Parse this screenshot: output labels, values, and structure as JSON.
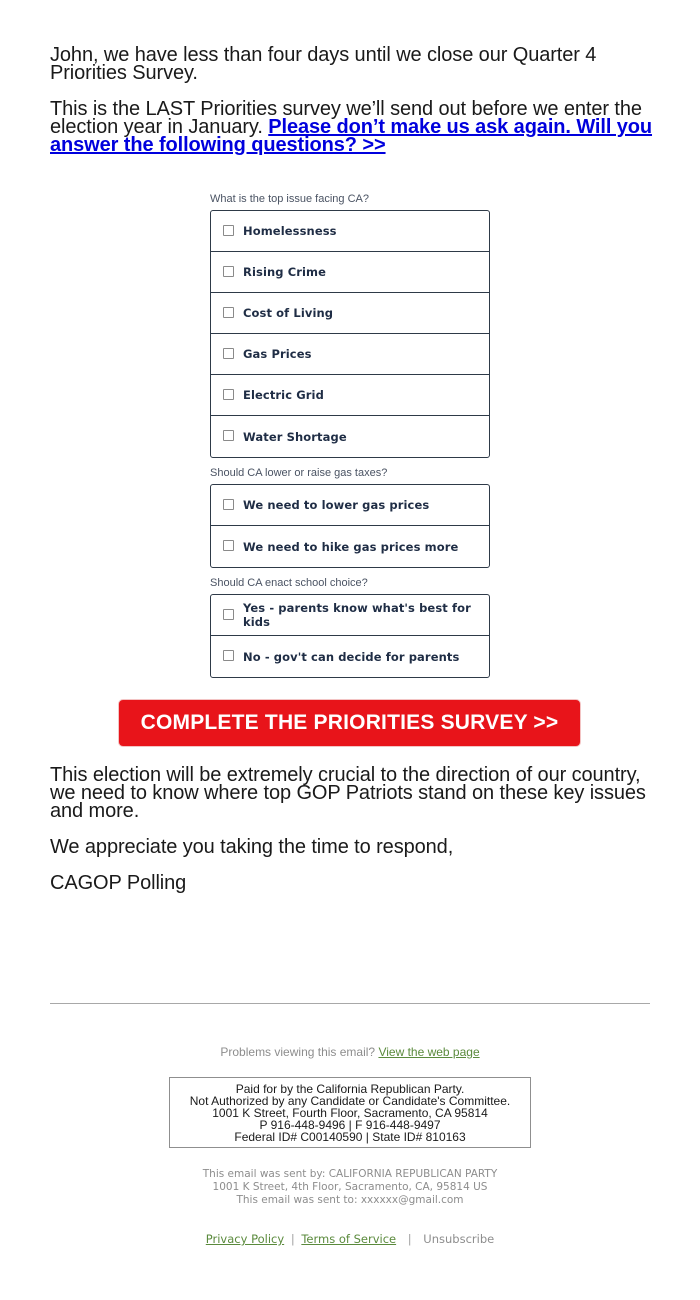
{
  "intro": {
    "para1": "John, we have less than four days until we close our Quarter 4 Priorities Survey.",
    "para2_text": "This is the LAST Priorities survey we’ll send out before we enter the election year in January. ",
    "para2_link": "Please don’t make us ask again. Will you answer the following questions? >>"
  },
  "survey": {
    "questions": [
      {
        "label": "What is the top issue facing CA?",
        "options": [
          "Homelessness",
          "Rising Crime",
          "Cost of Living",
          "Gas Prices",
          "Electric Grid",
          "Water Shortage"
        ]
      },
      {
        "label": "Should CA lower or raise gas taxes?",
        "options": [
          "We need to lower gas prices",
          "We need to hike gas prices more"
        ]
      },
      {
        "label": "Should CA enact school choice?",
        "options": [
          "Yes - parents know what's best for kids",
          "No - gov't can decide for parents"
        ]
      }
    ]
  },
  "cta": {
    "label": "COMPLETE THE PRIORITIES SURVEY >>",
    "color": "#e8141a"
  },
  "closing": {
    "para1": "This election will be extremely crucial to the direction of our country, we need to know where top GOP Patriots stand on these key issues and more.",
    "para2": "We appreciate you taking the time to respond,",
    "signature": "CAGOP Polling"
  },
  "footer": {
    "problems_text": "Problems viewing this email? ",
    "view_web_link": "View the web page",
    "disclaimer": [
      "Paid for by the California Republican Party.",
      "Not Authorized by any Candidate or Candidate's Committee.",
      "1001 K Street, Fourth Floor, Sacramento, CA 95814",
      "P 916-448-9496 | F 916-448-9497",
      "Federal ID# C00140590 | State ID# 810163"
    ],
    "sender": [
      "This email was sent by: CALIFORNIA REPUBLICAN PARTY",
      "1001 K Street, 4th Floor, Sacramento, CA, 95814 US",
      "This email was sent to: xxxxxx@gmail.com"
    ],
    "links": {
      "privacy": "Privacy Policy",
      "sep1": "|",
      "terms": "Terms of Service",
      "sep2": "|",
      "unsubscribe": "Unsubscribe"
    },
    "link_color": "#5a8a3c"
  }
}
